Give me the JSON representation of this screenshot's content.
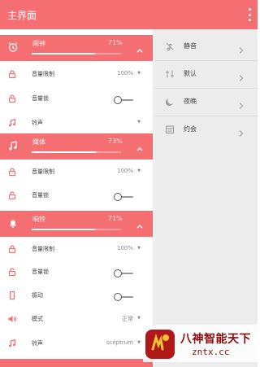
{
  "appbar": {
    "title": "主界面",
    "menu_icon": "more-vert-icon"
  },
  "colors": {
    "accent": "#f46e72",
    "right_panel_bg": "#ececec"
  },
  "sections": [
    {
      "name": "闹钟",
      "value": "71%",
      "level": 0.71,
      "icon": "alarm-clock-icon",
      "rows": [
        {
          "label": "音量限制",
          "value": "100%",
          "type": "dropdown",
          "icon": "lock-icon"
        },
        {
          "label": "音量锁",
          "type": "toggle",
          "icon": "lock-open-icon"
        },
        {
          "label": "铃声",
          "value": "",
          "type": "dropdown",
          "icon": "music-note-icon"
        }
      ]
    },
    {
      "name": "媒体",
      "value": "73%",
      "level": 0.73,
      "icon": "music-note-icon",
      "rows": [
        {
          "label": "音量限制",
          "value": "100%",
          "type": "dropdown",
          "icon": "lock-icon"
        },
        {
          "label": "音量锁",
          "type": "toggle",
          "icon": "lock-open-icon"
        }
      ]
    },
    {
      "name": "响铃",
      "value": "71%",
      "level": 0.71,
      "icon": "bell-icon",
      "rows": [
        {
          "label": "音量限制",
          "value": "100%",
          "type": "dropdown",
          "icon": "lock-icon"
        },
        {
          "label": "音量锁",
          "type": "toggle",
          "icon": "lock-open-icon"
        },
        {
          "label": "振动",
          "type": "toggle",
          "icon": "vibrate-phone-icon"
        },
        {
          "label": "模式",
          "value": "正常",
          "type": "dropdown",
          "icon": "speaker-icon"
        },
        {
          "label": "铃声",
          "value": "sceptrum",
          "type": "dropdown",
          "icon": "music-note-icon"
        }
      ]
    }
  ],
  "profiles": [
    {
      "label": "静音",
      "icon": "mute-icon"
    },
    {
      "label": "默认",
      "icon": "tune-icon"
    },
    {
      "label": "夜晚",
      "icon": "moon-icon"
    },
    {
      "label": "约会",
      "icon": "calendar-icon"
    }
  ],
  "watermark": {
    "cn": "八神智能天下",
    "en": "zntx.cc"
  }
}
